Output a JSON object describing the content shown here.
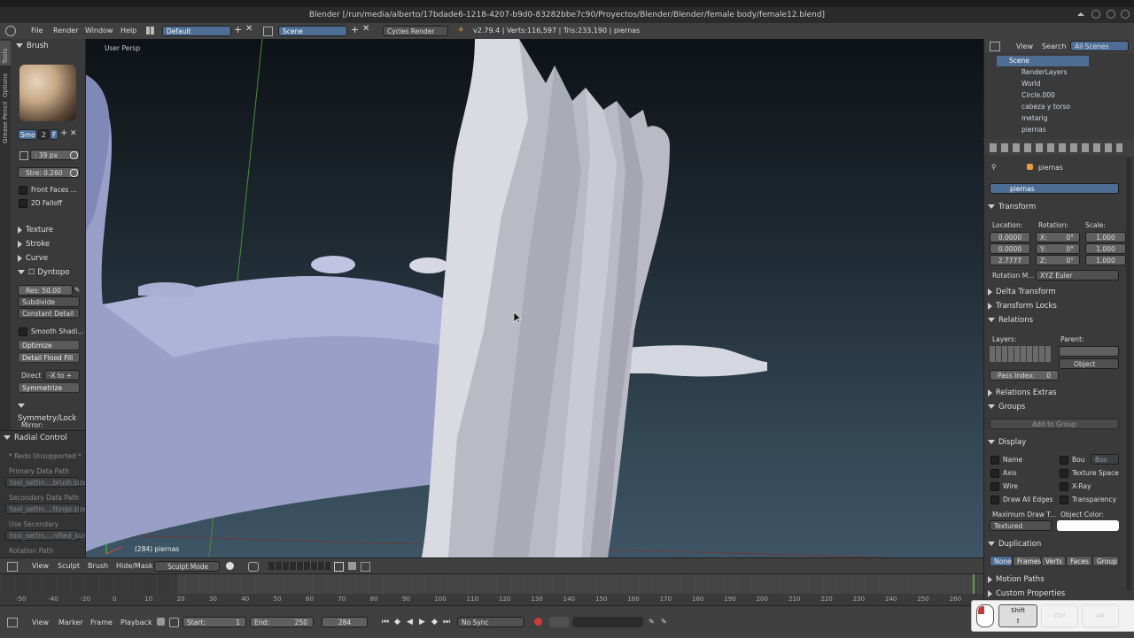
{
  "window": {
    "title": "Blender [/run/media/alberto/17bdade6-1218-4207-b9d0-83282bbe7c90/Proyectos/Blender/Blender/female body/female12.blend]"
  },
  "menubar": {
    "menus": [
      "File",
      "Render",
      "Window",
      "Help"
    ],
    "layout": "Default",
    "scene": "Scene",
    "engine": "Cycles Render",
    "stats": "v2.79.4 | Verts:116,597 | Tris:233,190 | piernas"
  },
  "tool_tabs": [
    "Tools",
    "Options",
    "Grease Pencil"
  ],
  "tools": {
    "brush_header": "Brush",
    "brush_name": "Smo",
    "brush_users": "2",
    "brush_fake": "F",
    "radius": ": 39 px",
    "strength": "Stre: 0.260",
    "front_faces": "Front Faces ...",
    "falloff_2d": "2D Falloff",
    "texture": "Texture",
    "stroke": "Stroke",
    "curve": "Curve",
    "dyntopo": "Dyntopo",
    "resolution": "Res: 50.00",
    "subdivide": "Subdivide Colla...",
    "detail_mode": "Constant Detail",
    "smooth_shading": "Smooth Shadi...",
    "optimize": "Optimize",
    "detail_flood": "Detail Flood Fill",
    "direction_label": "Direct",
    "direction_value": "-X to +",
    "symmetrize": "Symmetrize",
    "symmetry": "Symmetry/Lock",
    "mirror": "Mirror:"
  },
  "radial": {
    "header": "Radial Control",
    "redo": "* Redo Unsupported *",
    "primary_label": "Primary Data Path",
    "primary_value": "tool_settin....brush.size",
    "secondary_label": "Secondary Data Path",
    "secondary_value": "tool_settin....ttings.size",
    "use_secondary_label": "Use Secondary",
    "use_secondary_value": "tool_settin....nified_size",
    "rotation_label": "Rotation Path"
  },
  "viewport": {
    "view_name": "User Persp",
    "object_info": "(284) piernas"
  },
  "viewport_header": {
    "items": [
      "View",
      "Sculpt",
      "Brush",
      "Hide/Mask"
    ],
    "mode": "Sculpt Mode"
  },
  "outliner": {
    "view": "View",
    "search": "Search",
    "filter": "All Scenes",
    "items": [
      "Scene",
      "RenderLayers",
      "World",
      "Circle.000",
      "cabeza y torso",
      "metarig",
      "piernas"
    ]
  },
  "properties": {
    "object_label": "piernas",
    "object_name": "piernas",
    "transform": "Transform",
    "location_label": "Location:",
    "rotation_label": "Rotation:",
    "scale_label": "Scale:",
    "location": [
      "0.0000",
      "0.0000",
      "2.7777"
    ],
    "rotation": [
      {
        "axis": "X:",
        "value": "0°"
      },
      {
        "axis": "Y:",
        "value": "0°"
      },
      {
        "axis": "Z:",
        "value": "0°"
      }
    ],
    "scale": [
      "1.000",
      "1.000",
      "1.000"
    ],
    "rotation_mode_label": "Rotation M...",
    "rotation_mode": "XYZ Euler",
    "delta_transform": "Delta Transform",
    "transform_locks": "Transform Locks",
    "relations": "Relations",
    "layers_label": "Layers:",
    "parent_label": "Parent:",
    "parent_type": "Object",
    "pass_index_label": "Pass Index:",
    "pass_index": "0",
    "relations_extras": "Relations Extras",
    "groups": "Groups",
    "add_to_group": "Add to Group",
    "display": "Display",
    "display_left": [
      "Name",
      "Axis",
      "Wire",
      "Draw All Edges"
    ],
    "display_right": [
      "Bou",
      "Texture Space",
      "X-Ray",
      "Transparency"
    ],
    "bounds_type": "Box",
    "max_draw_label": "Maximum Draw T...",
    "max_draw_value": "Textured",
    "object_color_label": "Object Color:",
    "duplication": "Duplication",
    "dup_options": [
      "None",
      "Frames",
      "Verts",
      "Faces",
      "Group"
    ],
    "motion_paths": "Motion Paths",
    "custom_properties": "Custom Properties"
  },
  "timeline": {
    "ticks": [
      "-50",
      "-40",
      "-20",
      "0",
      "10",
      "20",
      "30",
      "40",
      "50",
      "60",
      "70",
      "80",
      "90",
      "100",
      "110",
      "120",
      "130",
      "140",
      "150",
      "160",
      "170",
      "180",
      "190",
      "200",
      "210",
      "220",
      "230",
      "240",
      "250",
      "260"
    ],
    "menus": [
      "View",
      "Marker",
      "Frame",
      "Playback"
    ],
    "start": "Start:",
    "start_value": "1",
    "end": "End:",
    "end_value": "250",
    "current_frame": "284",
    "sync": "No Sync"
  },
  "keys": {
    "shift": "Shift",
    "ctrl": "Ctrl",
    "alt": "Alt"
  },
  "colors": {
    "accent": "#4d6d94",
    "panel": "#404040",
    "viewport_top": "#101418",
    "viewport_bottom": "#3e5566"
  }
}
